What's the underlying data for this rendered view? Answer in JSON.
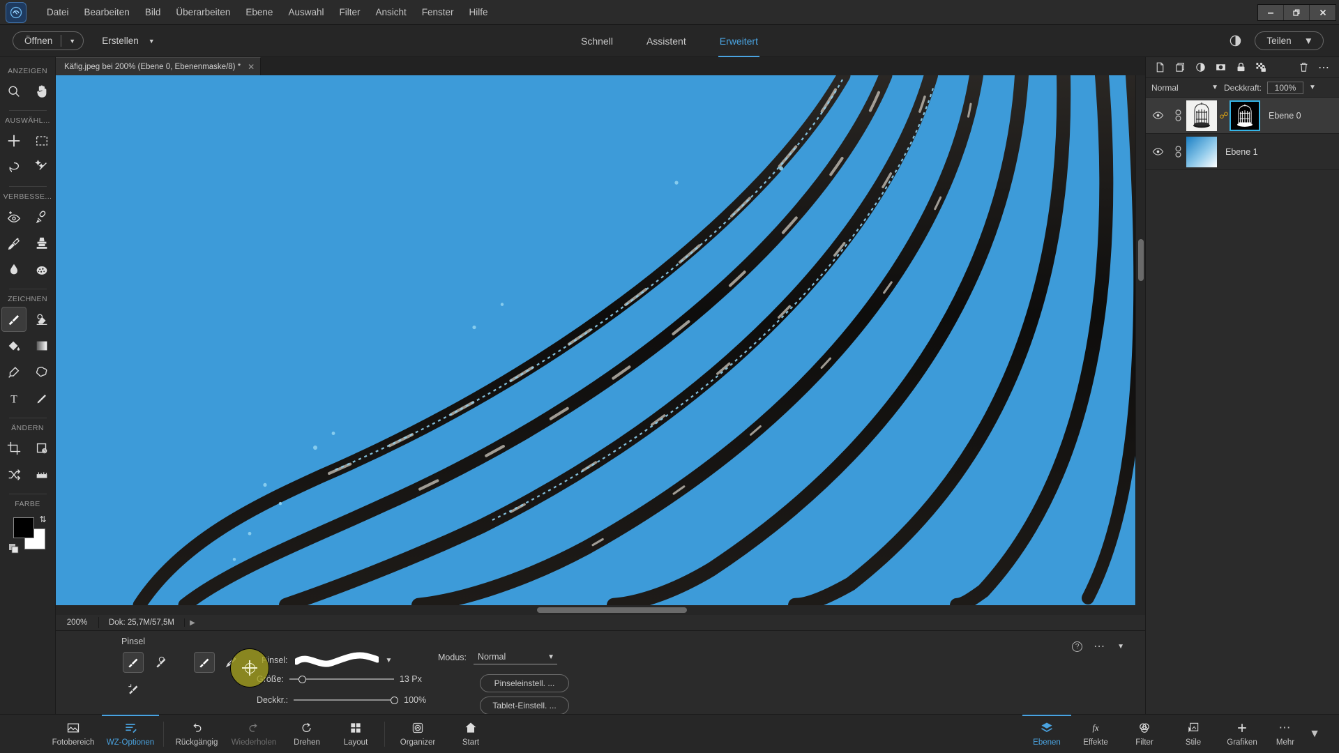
{
  "window": {
    "controls": [
      "minimize",
      "restore",
      "close"
    ],
    "app_icon": "photoshop-elements-logo"
  },
  "menubar": {
    "items": [
      "Datei",
      "Bearbeiten",
      "Bild",
      "Überarbeiten",
      "Ebene",
      "Auswahl",
      "Filter",
      "Ansicht",
      "Fenster",
      "Hilfe"
    ]
  },
  "modebar": {
    "open_label": "Öffnen",
    "create_label": "Erstellen",
    "tabs": [
      {
        "label": "Schnell",
        "active": false
      },
      {
        "label": "Assistent",
        "active": false
      },
      {
        "label": "Erweitert",
        "active": true
      }
    ],
    "share_label": "Teilen",
    "contrast_icon": "contrast-icon",
    "accent_color": "#4aa3e0"
  },
  "toolbar": {
    "groups": [
      {
        "label": "ANZEIGEN",
        "tools": [
          {
            "name": "zoom-tool",
            "icon": "magnifier-icon",
            "active": false
          },
          {
            "name": "hand-tool",
            "icon": "hand-icon",
            "active": false
          }
        ]
      },
      {
        "label": "AUSWÄHL...",
        "tools": [
          {
            "name": "move-tool",
            "icon": "move-cross-icon",
            "active": false
          },
          {
            "name": "rectangular-marquee-tool",
            "icon": "marquee-icon",
            "active": false
          },
          {
            "name": "lasso-tool",
            "icon": "lasso-icon",
            "active": false
          },
          {
            "name": "magic-wand-tool",
            "icon": "magic-wand-icon",
            "active": false
          }
        ]
      },
      {
        "label": "VERBESSE...",
        "tools": [
          {
            "name": "red-eye-removal-tool",
            "icon": "eye-plus-icon",
            "active": false
          },
          {
            "name": "spot-healing-brush-tool",
            "icon": "healing-brush-icon",
            "active": false
          },
          {
            "name": "smart-brush-tool",
            "icon": "paintbrush-sparkle-icon",
            "active": false
          },
          {
            "name": "clone-stamp-tool",
            "icon": "stamp-icon",
            "active": false
          },
          {
            "name": "blur-tool",
            "icon": "waterdrop-icon",
            "active": false
          },
          {
            "name": "sponge-tool",
            "icon": "sponge-icon",
            "active": false
          }
        ]
      },
      {
        "label": "ZEICHNEN",
        "tools": [
          {
            "name": "brush-tool",
            "icon": "paintbrush-icon",
            "active": true
          },
          {
            "name": "eraser-tool",
            "icon": "eraser-icon",
            "active": false
          },
          {
            "name": "paint-bucket-tool",
            "icon": "paint-bucket-icon",
            "active": false
          },
          {
            "name": "gradient-tool",
            "icon": "gradient-icon",
            "active": false
          },
          {
            "name": "color-picker-tool",
            "icon": "eyedropper-icon",
            "active": false
          },
          {
            "name": "custom-shape-tool",
            "icon": "star-shape-icon",
            "active": false
          },
          {
            "name": "type-tool",
            "icon": "type-t-icon",
            "active": false
          },
          {
            "name": "pencil-tool",
            "icon": "pencil-icon",
            "active": false
          }
        ]
      },
      {
        "label": "ÄNDERN",
        "tools": [
          {
            "name": "crop-tool",
            "icon": "crop-icon",
            "active": false
          },
          {
            "name": "recompose-tool",
            "icon": "frame-gear-icon",
            "active": false
          },
          {
            "name": "content-aware-move-tool",
            "icon": "shuffle-arrows-icon",
            "active": false
          },
          {
            "name": "straighten-tool",
            "icon": "straighten-icon",
            "active": false
          }
        ]
      }
    ],
    "color_label": "FARBE",
    "foreground_color": "#000000",
    "background_color": "#ffffff",
    "swap_icon": "swap-colors-icon",
    "default_icon": "default-colors-icon"
  },
  "document": {
    "tab_title": "Käfig.jpeg bei 200% (Ebene 0, Ebenenmaske/8) *",
    "close_icon": "close-icon",
    "canvas_sky_color": "#3d9bd9",
    "canvas_bar_color": "#191919"
  },
  "statusbar": {
    "zoom": "200%",
    "doc_info": "Dok: 25,7M/57,5M",
    "expand_icon": "chevron-right-icon"
  },
  "tool_options": {
    "title": "Pinsel",
    "tool_buttons": [
      {
        "name": "brush-tool-option",
        "icon": "paintbrush-icon",
        "active": true
      },
      {
        "name": "impressionist-brush-option",
        "icon": "impressionist-brush-icon",
        "active": false
      },
      {
        "name": "color-replacement-brush-option",
        "icon": "color-replace-brush-icon",
        "active": false
      }
    ],
    "tool_buttons_b": [
      {
        "name": "brush-variant-option",
        "icon": "paintbrush-icon",
        "active": true
      },
      {
        "name": "brush-detail-option",
        "icon": "detail-brush-icon",
        "active": false
      }
    ],
    "brush_label": "Pinsel:",
    "brush_preview": "soft-round-stroke-preview",
    "size_label": "Größe:",
    "size_value": "13 Px",
    "size_percent": 9,
    "opacity_label": "Deckkr.:",
    "opacity_value": "100%",
    "opacity_percent": 100,
    "mode_label": "Modus:",
    "mode_value": "Normal",
    "brush_settings_label": "Pinseleinstell. ...",
    "tablet_settings_label": "Tablet-Einstell. ...",
    "help_icon": "help-icon",
    "more_icon": "ellipsis-icon",
    "collapse_icon": "chevron-down-icon",
    "cursor_highlight_color": "#a4a01e"
  },
  "layers_panel": {
    "toolbar_icons": [
      "new-layer-icon",
      "duplicate-layer-icon",
      "adjustment-layer-icon",
      "layer-mask-icon",
      "lock-all-icon",
      "lock-transparency-icon",
      "delete-layer-icon",
      "panel-menu-icon"
    ],
    "blend_mode": "Normal",
    "opacity_label": "Deckkraft:",
    "opacity_value": "100%",
    "layers": [
      {
        "name": "Ebene 0",
        "selected": true,
        "visible": true,
        "thumb": "birdcage-photo-thumbnail",
        "has_mask": true,
        "mask_thumb": "birdcage-mask-thumbnail",
        "mask_selected": true,
        "link_icon": "chain-link-icon",
        "eye_icon": "eye-icon"
      },
      {
        "name": "Ebene 1",
        "selected": false,
        "visible": true,
        "thumb": "blue-gradient-thumbnail",
        "has_mask": false,
        "eye_icon": "eye-icon"
      }
    ],
    "mask_select_color": "#36b6e8"
  },
  "bottombar": {
    "left_items": [
      {
        "label": "Fotobereich",
        "icon": "photo-bin-icon",
        "active": false
      },
      {
        "label": "WZ-Optionen",
        "icon": "tool-options-icon",
        "active": true
      },
      {
        "label": "Rückgängig",
        "icon": "undo-arrow-icon",
        "active": false
      },
      {
        "label": "Wiederholen",
        "icon": "redo-arrow-icon",
        "active": false,
        "disabled": true
      },
      {
        "label": "Drehen",
        "icon": "rotate-icon",
        "active": false
      },
      {
        "label": "Layout",
        "icon": "layout-grid-icon",
        "active": false
      },
      {
        "label": "Organizer",
        "icon": "organizer-icon",
        "active": false
      },
      {
        "label": "Start",
        "icon": "home-icon",
        "active": false
      }
    ],
    "right_items": [
      {
        "label": "Ebenen",
        "icon": "layers-stack-icon",
        "active": true
      },
      {
        "label": "Effekte",
        "icon": "fx-icon",
        "active": false
      },
      {
        "label": "Filter",
        "icon": "filter-circles-icon",
        "active": false
      },
      {
        "label": "Stile",
        "icon": "styles-icon",
        "active": false
      },
      {
        "label": "Grafiken",
        "icon": "plus-icon",
        "active": false
      },
      {
        "label": "Mehr",
        "icon": "ellipsis-icon",
        "active": false
      }
    ],
    "caret_icon": "chevron-down-icon"
  }
}
